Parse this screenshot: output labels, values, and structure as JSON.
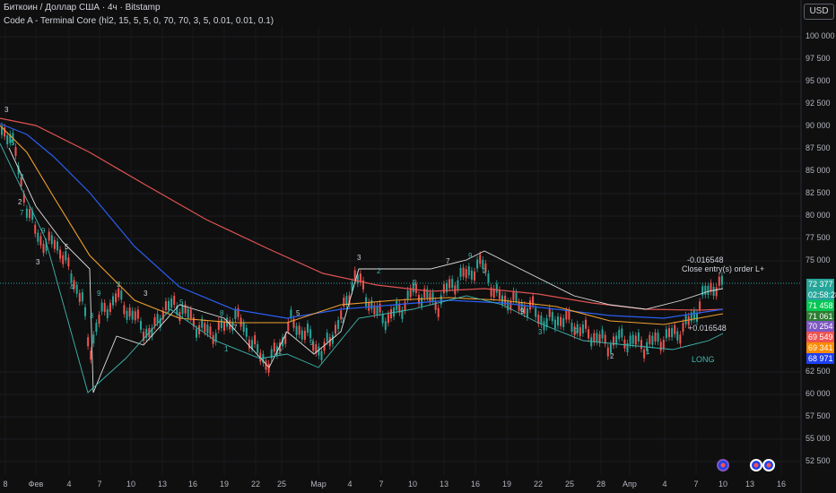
{
  "header": {
    "symbol_line": "Биткоин / Доллар США · 4ч · Bitstamp",
    "indicator_line": "Code A - Terminal Core (hl2, 15, 5, 5, 0, 70, 70, 3, 5, 0.01, 0.01, 0.1)"
  },
  "currency_button": "USD",
  "colors": {
    "background": "#0f0f0f",
    "up_candle": "#26a69a",
    "down_candle": "#ef5350",
    "ma_red": "#e05252",
    "ma_blue": "#2a5ef2",
    "ma_orange": "#f0a030",
    "trail_white": "#e0e0e0",
    "trail_teal": "#3fb8b0"
  },
  "price_axis": {
    "ticks": [
      "100 000",
      "97 500",
      "95 000",
      "92 500",
      "90 000",
      "87 500",
      "85 000",
      "82 500",
      "80 000",
      "77 500",
      "75 000",
      "62 500",
      "60 000",
      "57 500",
      "55 000",
      "52 500"
    ]
  },
  "time_axis": {
    "ticks": [
      "8",
      "Фев",
      "4",
      "7",
      "10",
      "13",
      "16",
      "19",
      "22",
      "25",
      "Мар",
      "4",
      "7",
      "10",
      "13",
      "16",
      "19",
      "22",
      "25",
      "28",
      "Апр",
      "4",
      "7",
      "10",
      "13",
      "16"
    ]
  },
  "price_labels": [
    {
      "text": "72 377",
      "color": "#26a69a"
    },
    {
      "text": "02:58:28",
      "color": "#26a69a"
    },
    {
      "text": "71 458",
      "color": "#00c853"
    },
    {
      "text": "71 061",
      "color": "#2e7d32"
    },
    {
      "text": "70 254",
      "color": "#7e57c2"
    },
    {
      "text": "69 549",
      "color": "#ef5350"
    },
    {
      "text": "69 341",
      "color": "#fb8c00"
    },
    {
      "text": "68 971",
      "color": "#1e3ff0"
    }
  ],
  "annotations": {
    "order_value_top": "-0.016548",
    "order_close_text": "Close entry(s) order L+",
    "order_value_bottom": "+0.016548",
    "long_label": "LONG"
  },
  "wave_labels": [
    "3",
    "5",
    "3",
    "2",
    "7",
    "9",
    "3",
    "4",
    "3",
    "5",
    "9",
    "2",
    "3",
    "5",
    "8",
    "7",
    "1",
    "2",
    "5",
    "9",
    "1",
    "3",
    "2",
    "5",
    "7",
    "9",
    "2",
    "9",
    "3",
    "9",
    "2",
    "1"
  ],
  "events": [
    {
      "icon": "event-flag-icon"
    },
    {
      "icon": "event-flag-icon"
    },
    {
      "icon": "event-flag-icon"
    }
  ]
}
